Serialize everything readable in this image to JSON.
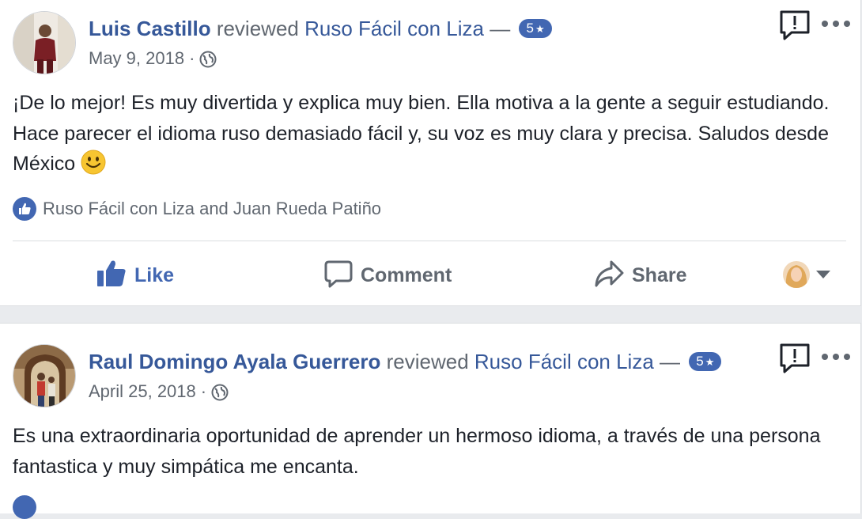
{
  "reviews": [
    {
      "reviewer": "Luis Castillo",
      "action_text": "reviewed",
      "page": "Ruso Fácil con Liza",
      "dash": "—",
      "rating": "5",
      "rating_star": "★",
      "date": "May 9, 2018",
      "separator": "·",
      "audience_icon": "globe-icon",
      "text": "¡De lo mejor! Es muy divertida y explica muy bien. Ella motiva a la gente a seguir estudiando. Hace parecer el idioma ruso demasiado fácil y, su voz es muy clara y precisa. Saludos desde México",
      "likers": "Ruso Fácil con Liza and Juan Rueda Patiño"
    },
    {
      "reviewer": "Raul Domingo Ayala Guerrero",
      "action_text": "reviewed",
      "page": "Ruso Fácil con Liza",
      "dash": "—",
      "rating": "5",
      "rating_star": "★",
      "date": "April 25, 2018",
      "separator": "·",
      "audience_icon": "globe-icon",
      "text": "Es una extraordinaria oportunidad de aprender un hermoso idioma, a través de una persona fantastica y muy simpática me encanta."
    }
  ],
  "actions": {
    "like": "Like",
    "comment": "Comment",
    "share": "Share"
  },
  "colors": {
    "link": "#365899",
    "accent": "#4267b2",
    "secondary_text": "#606770",
    "background": "#e9ebee"
  }
}
